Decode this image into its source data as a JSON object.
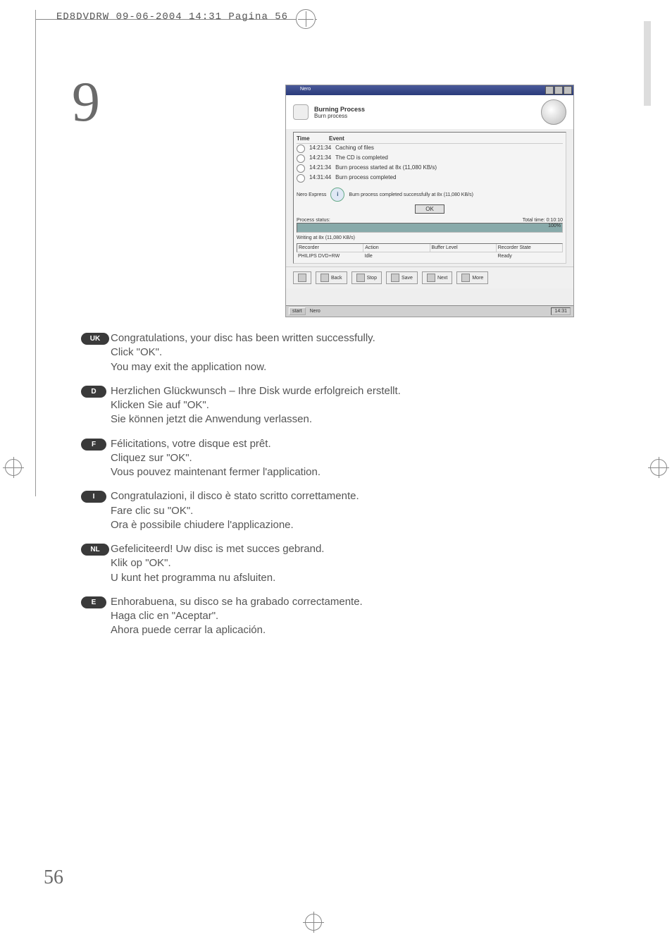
{
  "header": {
    "text": "ED8DVDRW  09-06-2004  14:31  Pagina 56"
  },
  "step_number": "9",
  "page_number": "56",
  "screenshot": {
    "window_title": "Nero",
    "heading": "Burning Process",
    "subheading": "Burn process",
    "log_header_time": "Time",
    "log_header_event": "Event",
    "log": [
      {
        "time": "14:21:34",
        "event": "Caching of files"
      },
      {
        "time": "14:21:34",
        "event": "The CD is completed"
      },
      {
        "time": "14:21:34",
        "event": "Burn process started at 8x (11,080 KB/s)"
      },
      {
        "time": "14:31:44",
        "event": "Burn process completed"
      }
    ],
    "info_title": "Nero Express",
    "info_message": "Burn process completed successfully at 8x (11,080 KB/s)",
    "ok_button": "OK",
    "progress_prefix": "Process status:",
    "progress_pct": "100%",
    "total_time_label": "Total time:",
    "total_time_value": "0:10:10",
    "writing_label": "Writing at 8x (11,080 KB/s)",
    "recorder_cols": {
      "c1": "Recorder",
      "c2": "Action",
      "c3": "Buffer Level",
      "c4": "Recorder State"
    },
    "recorder_row": {
      "c1": "PHILIPS DVD+RW",
      "c2": "Idle",
      "c3": "",
      "c4": "Ready"
    },
    "bottom_buttons": {
      "b1": "Back",
      "b2": "Stop",
      "b3": "Save",
      "b4": "Next",
      "b5": "More"
    },
    "taskbar_start": "start",
    "taskbar_items": "Nero",
    "taskbar_clock": "14:31"
  },
  "languages": [
    {
      "code": "UK",
      "lines": [
        "Congratulations, your disc has been written successfully.",
        "Click \"OK\".",
        "You may exit the application now."
      ]
    },
    {
      "code": "D",
      "lines": [
        "Herzlichen Glückwunsch – Ihre Disk wurde erfolgreich erstellt.",
        "Klicken Sie auf \"OK\".",
        "Sie können jetzt die Anwendung verlassen."
      ]
    },
    {
      "code": "F",
      "lines": [
        "Félicitations, votre disque est prêt.",
        "Cliquez sur \"OK\".",
        "Vous pouvez maintenant fermer l'application."
      ]
    },
    {
      "code": "I",
      "lines": [
        "Congratulazioni, il disco è stato scritto correttamente.",
        "Fare clic su \"OK\".",
        "Ora è possibile chiudere l'applicazione."
      ]
    },
    {
      "code": "NL",
      "lines": [
        "Gefeliciteerd! Uw disc is met succes gebrand.",
        "Klik op \"OK\".",
        "U kunt het programma nu afsluiten."
      ]
    },
    {
      "code": "E",
      "lines": [
        "Enhorabuena, su disco se ha grabado correctamente.",
        "Haga clic en \"Aceptar\".",
        "Ahora puede cerrar la aplicación."
      ]
    }
  ]
}
